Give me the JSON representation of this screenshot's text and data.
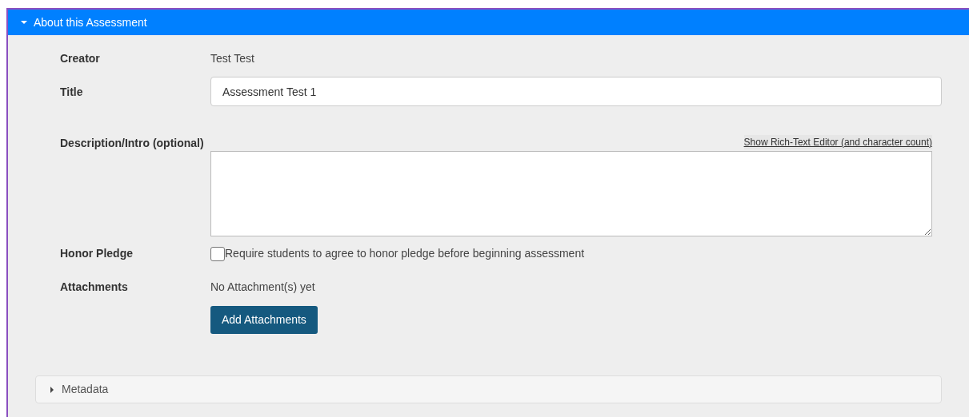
{
  "section": {
    "title": "About this Assessment",
    "expanded": true
  },
  "creator": {
    "label": "Creator",
    "value": "Test Test"
  },
  "title_field": {
    "label": "Title",
    "value": "Assessment Test 1"
  },
  "description": {
    "label": "Description/Intro (optional)",
    "link": "Show Rich-Text Editor (and character count)"
  },
  "honor_pledge": {
    "label": "Honor Pledge",
    "text": "Require students to agree to honor pledge before beginning assessment",
    "checked": false
  },
  "attachments": {
    "label": "Attachments",
    "value": "No Attachment(s) yet",
    "button": "Add Attachments"
  },
  "metadata": {
    "title": "Metadata",
    "expanded": false
  }
}
